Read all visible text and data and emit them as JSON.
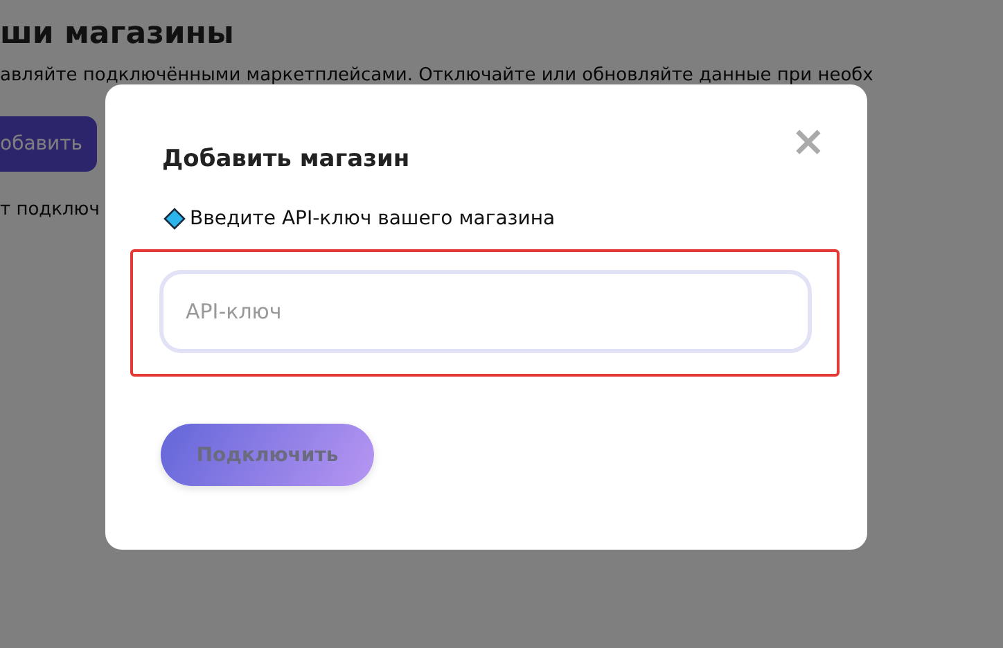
{
  "page": {
    "title": "ши магазины",
    "subtitle": "авляйте подключёнными маркетплейсами. Отключайте или обновляйте данные при необх",
    "add_button": "обавить",
    "note": "т подключ"
  },
  "modal": {
    "title": "Добавить магазин",
    "close": "×",
    "label": "Введите API-ключ вашего магазина",
    "field": {
      "placeholder": "API-ключ",
      "highlighted": true
    },
    "button": {
      "label": "Подключить",
      "disabled": true
    }
  }
}
